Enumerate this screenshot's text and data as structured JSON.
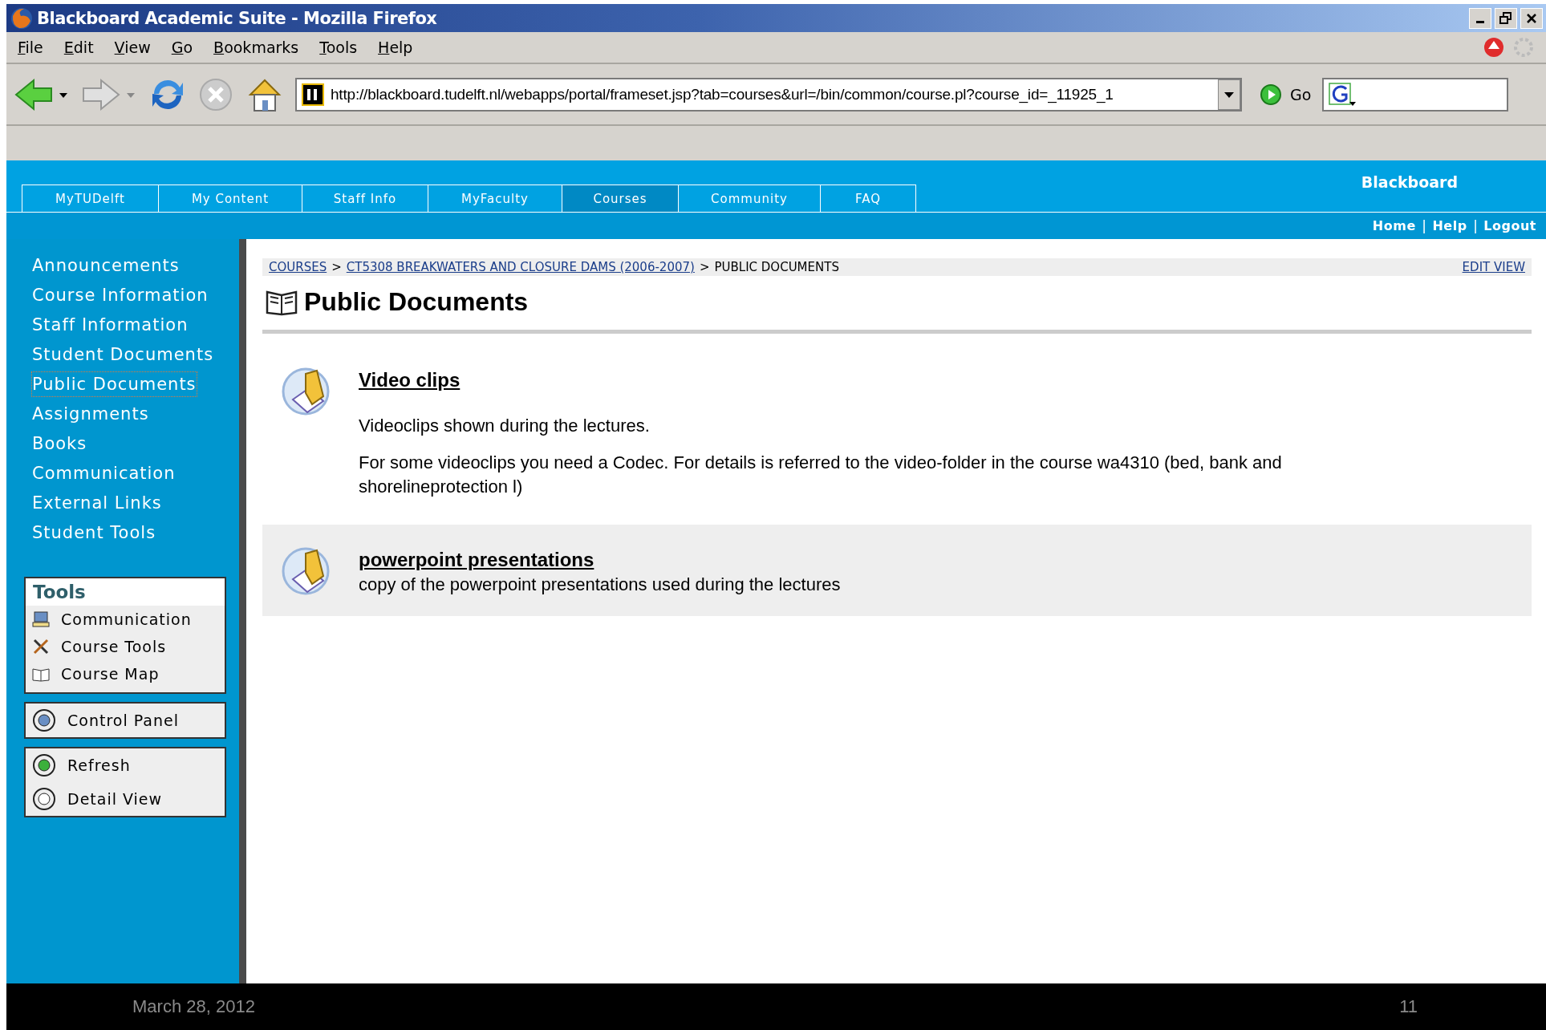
{
  "window": {
    "title": "Blackboard Academic Suite - Mozilla Firefox"
  },
  "menu": [
    "File",
    "Edit",
    "View",
    "Go",
    "Bookmarks",
    "Tools",
    "Help"
  ],
  "toolbar": {
    "url": "http://blackboard.tudelft.nl/webapps/portal/frameset.jsp?tab=courses&url=/bin/common/course.pl?course_id=_11925_1",
    "go": "Go"
  },
  "portal": {
    "brand": "Blackboard",
    "tabs": [
      {
        "label": "MyTUDelft",
        "selected": false
      },
      {
        "label": "My Content",
        "selected": false
      },
      {
        "label": "Staff Info",
        "selected": false
      },
      {
        "label": "MyFaculty",
        "selected": false
      },
      {
        "label": "Courses",
        "selected": true
      },
      {
        "label": "Community",
        "selected": false
      },
      {
        "label": "FAQ",
        "selected": false
      }
    ],
    "links": [
      {
        "kind": "link",
        "text": "Home"
      },
      {
        "kind": "separator",
        "text": "|"
      },
      {
        "kind": "link",
        "text": "Help"
      },
      {
        "kind": "separator",
        "text": "|"
      },
      {
        "kind": "link",
        "text": "Logout"
      }
    ]
  },
  "sidebar": {
    "items": [
      {
        "label": "Announcements",
        "selected": false
      },
      {
        "label": "Course Information",
        "selected": false
      },
      {
        "label": "Staff Information",
        "selected": false
      },
      {
        "label": "Student Documents",
        "selected": false
      },
      {
        "label": "Public Documents",
        "selected": true
      },
      {
        "label": "Assignments",
        "selected": false
      },
      {
        "label": "Books",
        "selected": false
      },
      {
        "label": "Communication",
        "selected": false
      },
      {
        "label": "External Links",
        "selected": false
      },
      {
        "label": "Student Tools",
        "selected": false
      }
    ],
    "tools": {
      "title": "Tools",
      "items": [
        "Communication",
        "Course Tools",
        "Course Map"
      ]
    },
    "control_panel": "Control Panel",
    "actions": [
      "Refresh",
      "Detail View"
    ]
  },
  "content": {
    "breadcrumb": [
      {
        "kind": "link",
        "text": "COURSES"
      },
      {
        "kind": "separator",
        "text": ">"
      },
      {
        "kind": "link",
        "text": "CT5308 BREAKWATERS AND CLOSURE DAMS (2006-2007)"
      },
      {
        "kind": "separator",
        "text": ">"
      },
      {
        "kind": "current",
        "text": "PUBLIC DOCUMENTS"
      }
    ],
    "edit_view": "EDIT VIEW",
    "title": "Public Documents",
    "items": [
      {
        "title": "Video clips",
        "shaded": false,
        "paragraphs": [
          "Videoclips shown during the lectures.",
          "For some videoclips you need a Codec. For details is referred to the video-folder in the course wa4310 (bed, bank and shorelineprotection l)"
        ]
      },
      {
        "title": "powerpoint presentations",
        "shaded": true,
        "paragraphs": [
          "copy of the powerpoint presentations used during the lectures"
        ]
      }
    ]
  },
  "footer": {
    "date": "March 28, 2012",
    "page": "11"
  }
}
